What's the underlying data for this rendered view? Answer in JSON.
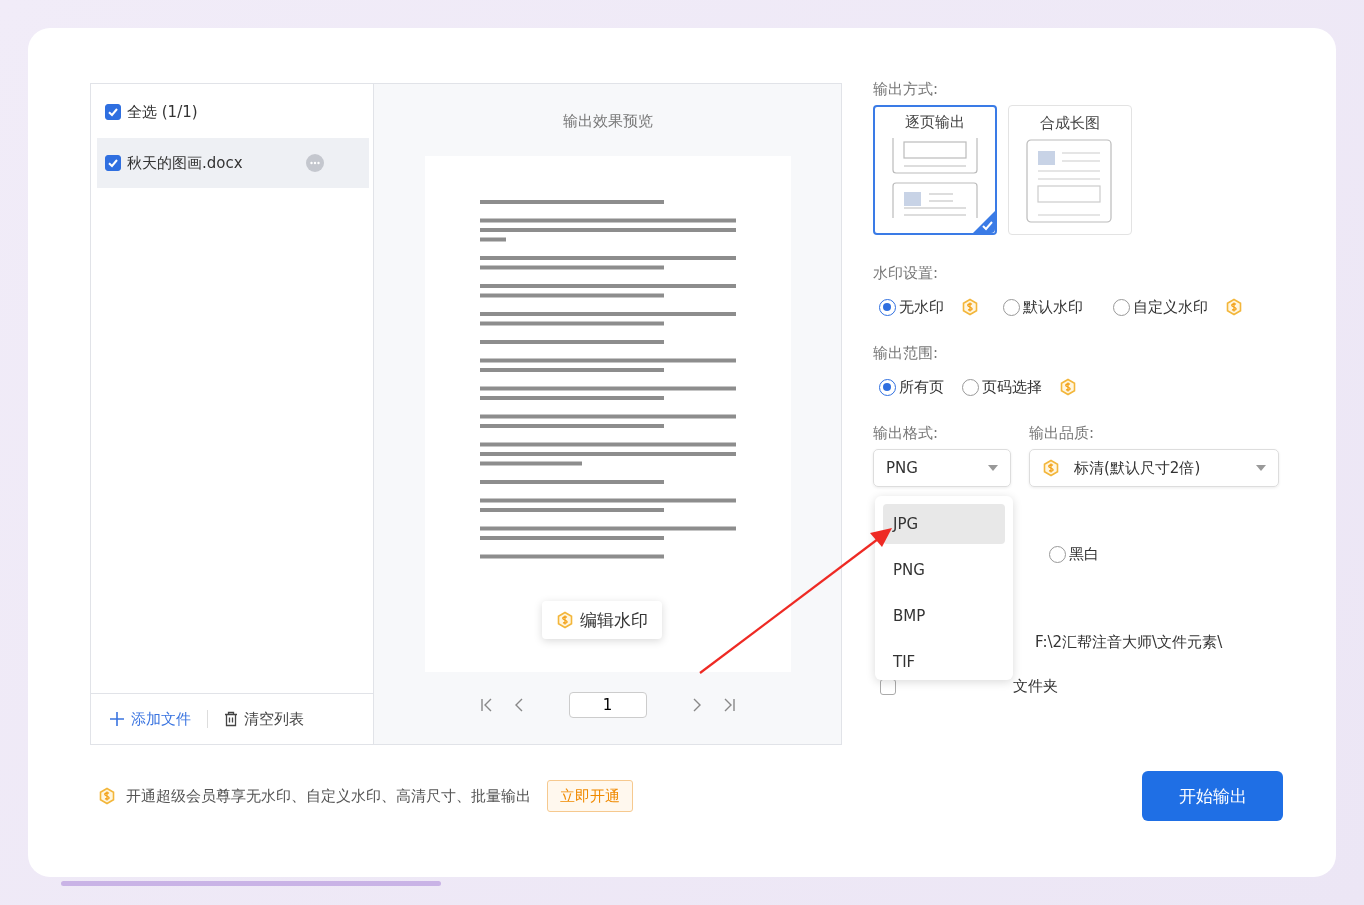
{
  "file_list": {
    "select_all": {
      "label": "全选 (1/1)",
      "checked": true
    },
    "files": [
      {
        "name": "秋天的图画.docx",
        "checked": true,
        "selected": true
      }
    ],
    "add_button": "添加文件",
    "clear_button": "清空列表"
  },
  "preview": {
    "title": "输出效果预览",
    "edit_watermark_button": "编辑水印",
    "page_input": "1"
  },
  "output_mode": {
    "label": "输出方式:",
    "options": [
      {
        "label": "逐页输出",
        "kind": "pages",
        "selected": true
      },
      {
        "label": "合成长图",
        "kind": "long",
        "selected": false
      }
    ]
  },
  "watermark": {
    "label": "水印设置:",
    "options": [
      {
        "label": "无水印",
        "selected": true,
        "premium": true
      },
      {
        "label": "默认水印",
        "selected": false,
        "premium": false
      },
      {
        "label": "自定义水印",
        "selected": false,
        "premium": true
      }
    ]
  },
  "range": {
    "label": "输出范围:",
    "options": [
      {
        "label": "所有页",
        "selected": true,
        "premium": false
      },
      {
        "label": "页码选择",
        "selected": false,
        "premium": true
      }
    ]
  },
  "format": {
    "label": "输出格式:",
    "value": "PNG",
    "options": [
      {
        "label": "JPG",
        "highlighted": true
      },
      {
        "label": "PNG",
        "highlighted": false
      },
      {
        "label": "BMP",
        "highlighted": false
      },
      {
        "label": "TIF",
        "highlighted": false
      }
    ]
  },
  "quality": {
    "label": "输出品质:",
    "value": "标清(默认尺寸2倍)",
    "premium": true
  },
  "color_mode": {
    "options": [
      {
        "label": "黑白",
        "selected": false
      }
    ]
  },
  "output_path": "F:\\2汇帮注音大师\\文件元素\\",
  "subfolder": {
    "label": "文件夹",
    "checked": false
  },
  "footer": {
    "promo": "开通超级会员尊享无水印、自定义水印、高清尺寸、批量输出",
    "upgrade_button": "立即开通",
    "start_button": "开始输出"
  }
}
